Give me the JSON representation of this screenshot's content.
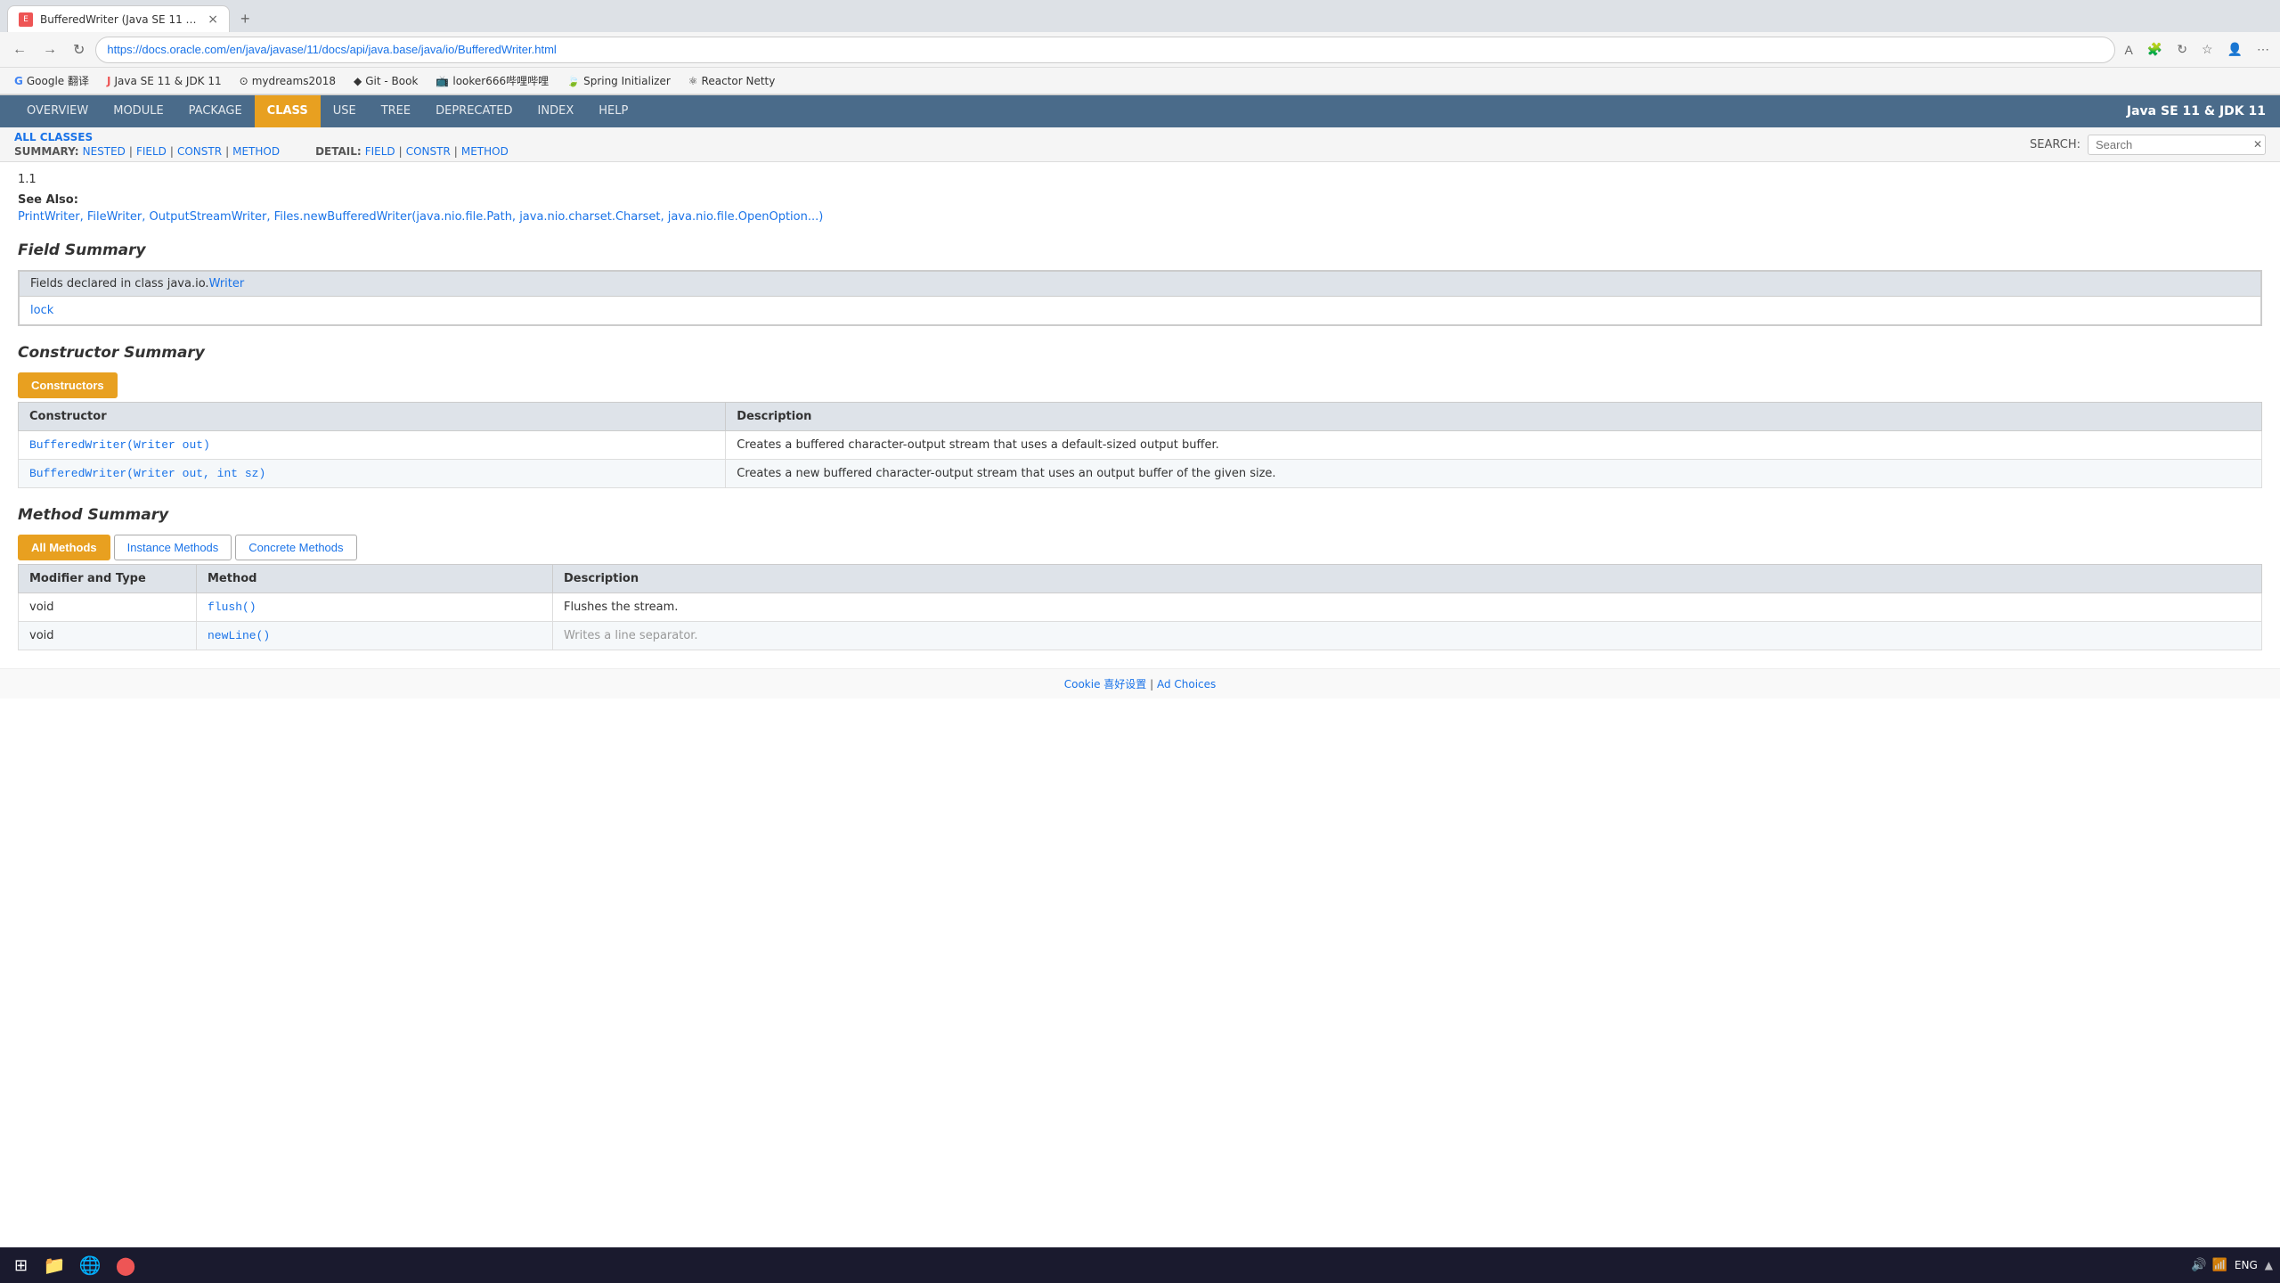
{
  "browser": {
    "tab_title": "BufferedWriter (Java SE 11 & JD...",
    "tab_favicon": "E",
    "url": "https://docs.oracle.com/en/java/javase/11/docs/api/java.base/java/io/BufferedWriter.html",
    "new_tab_label": "+",
    "close_tab_label": "×",
    "nav_back": "←",
    "nav_forward": "→",
    "nav_refresh": "↻",
    "bookmarks": [
      {
        "id": "google-translate",
        "label": "Google 翻译",
        "icon": "G"
      },
      {
        "id": "java-se-11",
        "label": "Java SE 11 & JDK 11",
        "icon": "J"
      },
      {
        "id": "mydreams2018",
        "label": "mydreams2018",
        "icon": "⊙"
      },
      {
        "id": "git-book",
        "label": "Git - Book",
        "icon": "◆"
      },
      {
        "id": "looker666",
        "label": "looker666哔哩哔哩",
        "icon": "📺"
      },
      {
        "id": "spring-initializer",
        "label": "Spring Initializer",
        "icon": "🍃"
      },
      {
        "id": "reactor-netty",
        "label": "Reactor Netty",
        "icon": "⚛"
      }
    ]
  },
  "java_nav": {
    "items": [
      {
        "id": "overview",
        "label": "OVERVIEW",
        "active": false
      },
      {
        "id": "module",
        "label": "MODULE",
        "active": false
      },
      {
        "id": "package",
        "label": "PACKAGE",
        "active": false
      },
      {
        "id": "class",
        "label": "CLASS",
        "active": true
      },
      {
        "id": "use",
        "label": "USE",
        "active": false
      },
      {
        "id": "tree",
        "label": "TREE",
        "active": false
      },
      {
        "id": "deprecated",
        "label": "DEPRECATED",
        "active": false
      },
      {
        "id": "index",
        "label": "INDEX",
        "active": false
      },
      {
        "id": "help",
        "label": "HELP",
        "active": false
      }
    ],
    "right_text": "Java SE 11 & JDK 11"
  },
  "sub_nav": {
    "all_classes_link": "ALL CLASSES",
    "search_label": "SEARCH:",
    "search_placeholder": "Search",
    "summary_label": "SUMMARY:",
    "summary_items": [
      "NESTED",
      "FIELD",
      "CONSTR",
      "METHOD"
    ],
    "detail_label": "DETAIL:",
    "detail_items": [
      "FIELD",
      "CONSTR",
      "METHOD"
    ]
  },
  "content": {
    "version_line": "1.1",
    "see_also_label": "See Also:",
    "see_also_links": [
      "PrintWriter",
      "FileWriter",
      "OutputStreamWriter",
      "Files.newBufferedWriter(java.nio.file.Path, java.nio.charset.Charset, java.nio.file.OpenOption...)"
    ],
    "field_summary": {
      "heading": "Field Summary",
      "declared_in": "Fields declared in class java.io.",
      "declared_class_link": "Writer",
      "fields": [
        "lock"
      ]
    },
    "constructor_summary": {
      "heading": "Constructor Summary",
      "tab_label": "Constructors",
      "col_constructor": "Constructor",
      "col_description": "Description",
      "rows": [
        {
          "constructor": "BufferedWriter(Writer out)",
          "constructor_link_text": "Writer",
          "description": "Creates a buffered character-output stream that uses a default-sized output buffer."
        },
        {
          "constructor": "BufferedWriter(Writer out, int sz)",
          "constructor_link_text": "Writer",
          "description": "Creates a new buffered character-output stream that uses an output buffer of the given size."
        }
      ]
    },
    "method_summary": {
      "heading": "Method Summary",
      "tabs": [
        {
          "id": "all-methods",
          "label": "All Methods",
          "active": true
        },
        {
          "id": "instance-methods",
          "label": "Instance Methods",
          "active": false
        },
        {
          "id": "concrete-methods",
          "label": "Concrete Methods",
          "active": false
        }
      ],
      "col_modifier": "Modifier and Type",
      "col_method": "Method",
      "col_description": "Description",
      "rows": [
        {
          "modifier": "void",
          "method": "flush()",
          "method_href": "#",
          "description": "Flushes the stream."
        },
        {
          "modifier": "void",
          "method": "newLine()",
          "method_href": "#",
          "description": "Writes a line separator."
        }
      ]
    }
  },
  "footer": {
    "text": "Cookie 喜好设置",
    "separator": "|",
    "ad_choices": "Ad Choices"
  },
  "taskbar": {
    "start_icon": "⊞",
    "items": [
      {
        "id": "explorer",
        "icon": "📁"
      },
      {
        "id": "edge",
        "icon": "🌐"
      },
      {
        "id": "intellij",
        "icon": "🔴"
      }
    ],
    "time": "ENG",
    "system_icons": [
      "🔊",
      "📶",
      "🔋"
    ]
  }
}
